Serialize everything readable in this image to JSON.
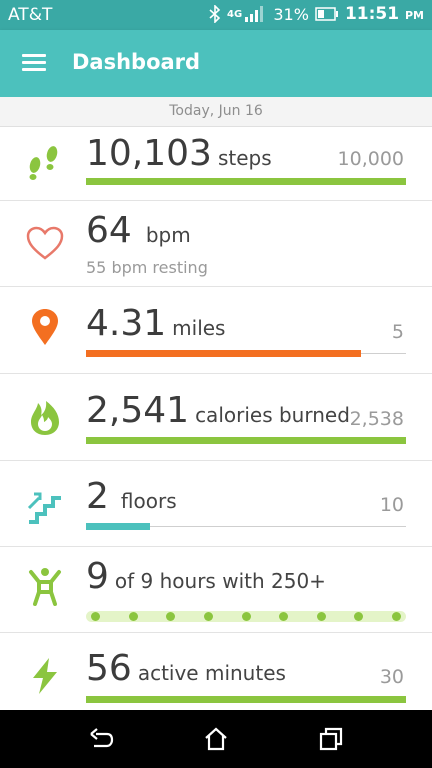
{
  "status_bar": {
    "carrier": "AT&T",
    "battery": "31%",
    "time": "11:51",
    "ampm": "PM"
  },
  "app_bar": {
    "title": "Dashboard"
  },
  "date": "Today, Jun 16",
  "colors": {
    "green": "#8bc53f",
    "orange": "#f36f21",
    "teal": "#4cc1bd",
    "heart": "#e8796a"
  },
  "tiles": {
    "steps": {
      "value": "10,103",
      "unit": "steps",
      "goal": "10,000",
      "progress": 1.0
    },
    "heart": {
      "value": "64",
      "unit": "bpm",
      "resting": "55 bpm resting"
    },
    "distance": {
      "value": "4.31",
      "unit": "miles",
      "goal": "5",
      "progress": 0.86
    },
    "calories": {
      "value": "2,541",
      "unit": "calories burned",
      "goal": "2,538",
      "progress": 1.0
    },
    "floors": {
      "value": "2",
      "unit": "floors",
      "goal": "10",
      "progress": 0.2
    },
    "hourly": {
      "value": "9",
      "unit": "of 9 hours with 250+",
      "hours_done": 9,
      "hours_total": 9
    },
    "active": {
      "value": "56",
      "unit": "active minutes",
      "goal": "30",
      "progress": 1.0
    }
  },
  "icons": [
    "bluetooth-icon",
    "lte-signal-icon",
    "battery-icon",
    "menu-icon",
    "footprints-icon",
    "heart-icon",
    "location-pin-icon",
    "flame-icon",
    "stairs-icon",
    "person-icon",
    "lightning-icon",
    "back-icon",
    "home-icon",
    "recents-icon"
  ]
}
